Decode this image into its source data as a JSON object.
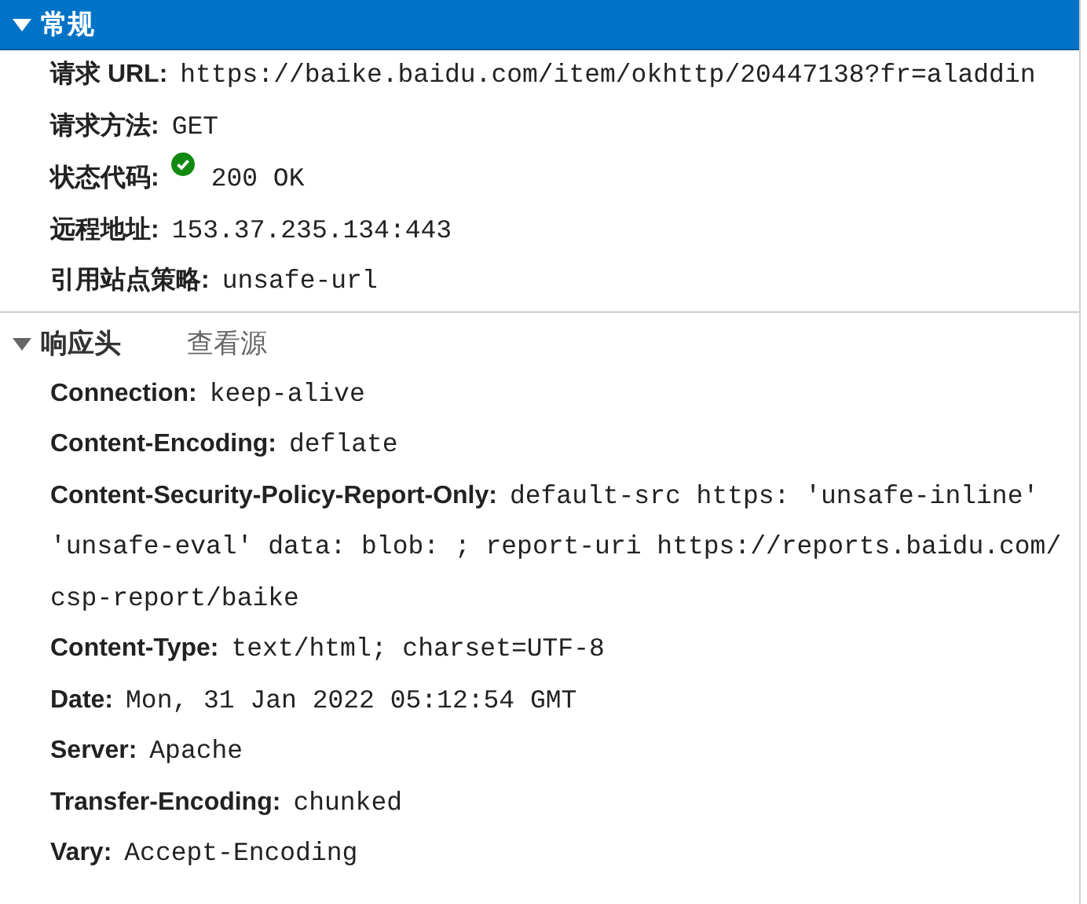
{
  "sections": [
    {
      "title": "常规",
      "selected": true,
      "expanded": true,
      "rows": [
        {
          "kind": "text",
          "name": "请求 URL:",
          "value": "https://baike.baidu.com/item/okhttp/20447138?fr=aladdin"
        },
        {
          "kind": "text",
          "name": "请求方法:",
          "value": "GET"
        },
        {
          "kind": "status",
          "name": "状态代码:",
          "value": "200 OK"
        },
        {
          "kind": "text",
          "name": "远程地址:",
          "value": "153.37.235.134:443"
        },
        {
          "kind": "text",
          "name": "引用站点策略:",
          "value": "unsafe-url"
        }
      ]
    },
    {
      "title": "响应头",
      "selected": false,
      "expanded": true,
      "link": "查看源",
      "rows": [
        {
          "kind": "text",
          "name": "Connection:",
          "value": "keep-alive"
        },
        {
          "kind": "text",
          "name": "Content-Encoding:",
          "value": "deflate"
        },
        {
          "kind": "text",
          "name": "Content-Security-Policy-Report-Only:",
          "value": "default-src https: 'unsafe-inline' 'unsafe-eval' data: blob: ; report-uri https://reports.baidu.com/csp-report/baike"
        },
        {
          "kind": "text",
          "name": "Content-Type:",
          "value": "text/html; charset=UTF-8"
        },
        {
          "kind": "text",
          "name": "Date:",
          "value": "Mon, 31 Jan 2022 05:12:54 GMT"
        },
        {
          "kind": "text",
          "name": "Server:",
          "value": "Apache"
        },
        {
          "kind": "text",
          "name": "Transfer-Encoding:",
          "value": "chunked"
        },
        {
          "kind": "text",
          "name": "Vary:",
          "value": "Accept-Encoding"
        }
      ]
    }
  ]
}
